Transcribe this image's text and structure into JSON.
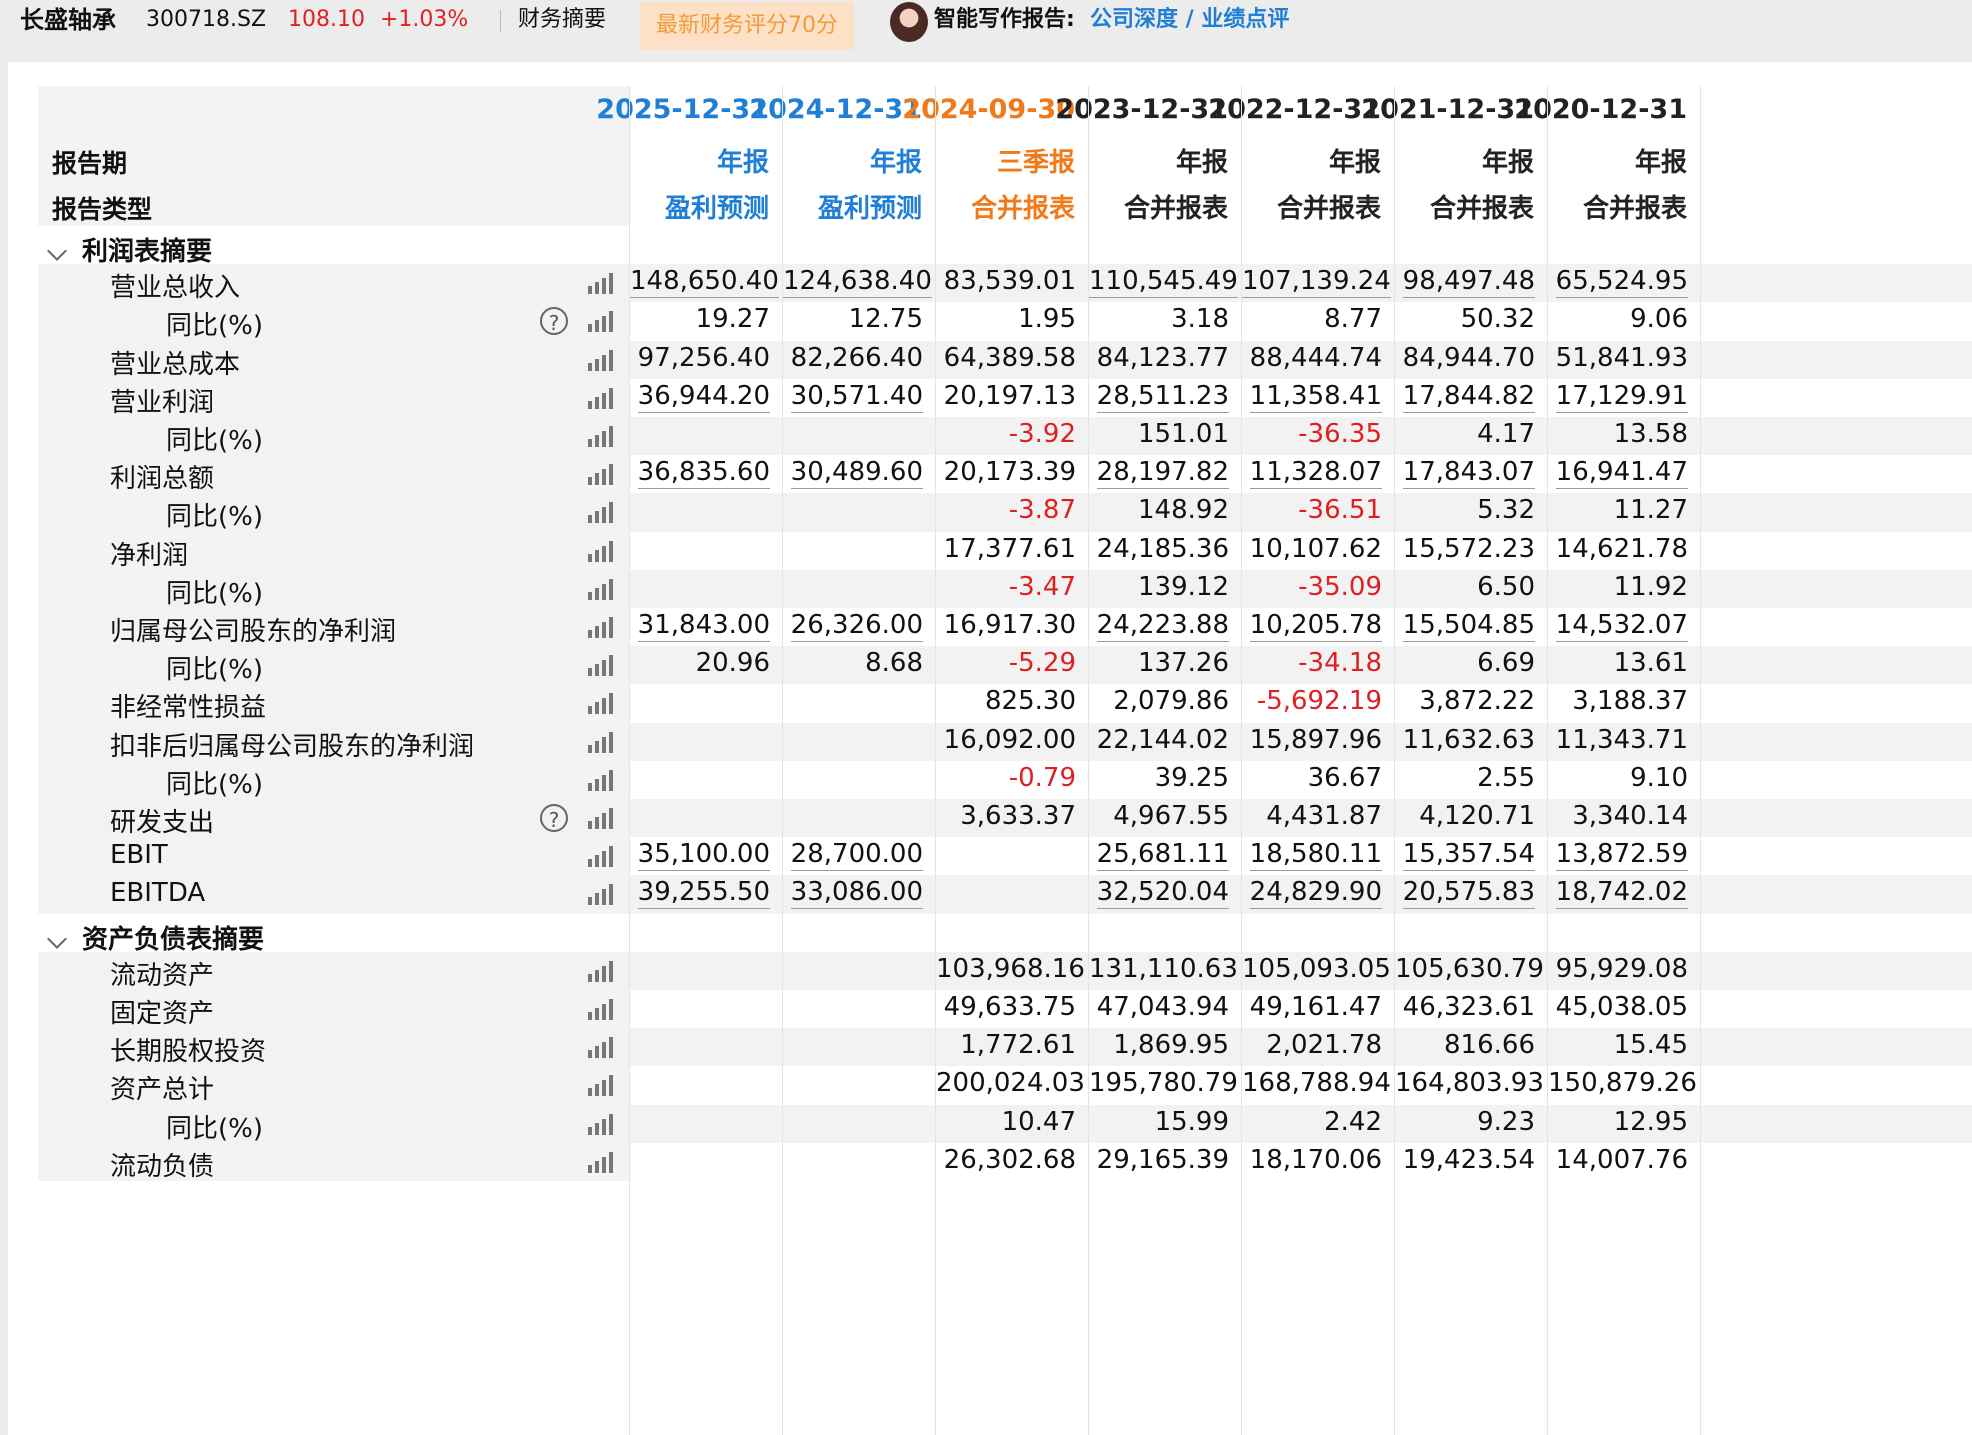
{
  "topbar": {
    "name": "长盛轴承",
    "code": "300718.SZ",
    "price": "108.10",
    "change": "+1.03%",
    "summary_label": "财务摘要",
    "score_label": "最新财务评分70分",
    "ai_label": "智能写作报告:",
    "ai_links": "公司深度 / 业绩点评",
    "avatar_icon": "avatar-icon"
  },
  "header": {
    "label_period": "报告期",
    "label_type": "报告类型",
    "columns": [
      {
        "date": "2025-12-31",
        "period": "年报",
        "kind": "盈利预测",
        "color": "#1f7fd6"
      },
      {
        "date": "2024-12-31",
        "period": "年报",
        "kind": "盈利预测",
        "color": "#1f7fd6"
      },
      {
        "date": "2024-09-30",
        "period": "三季报",
        "kind": "合并报表",
        "color": "#f07a1a"
      },
      {
        "date": "2023-12-31",
        "period": "年报",
        "kind": "合并报表",
        "color": "#222222"
      },
      {
        "date": "2022-12-31",
        "period": "年报",
        "kind": "合并报表",
        "color": "#222222"
      },
      {
        "date": "2021-12-31",
        "period": "年报",
        "kind": "合并报表",
        "color": "#222222"
      },
      {
        "date": "2020-12-31",
        "period": "年报",
        "kind": "合并报表",
        "color": "#222222"
      }
    ]
  },
  "rows": [
    {
      "type": "section",
      "name": "利润表摘要"
    },
    {
      "type": "item",
      "level": 1,
      "name": "营业总收入",
      "values": [
        "148,650.40",
        "124,638.40",
        "83,539.01",
        "110,545.49",
        "107,139.24",
        "98,497.48",
        "65,524.95"
      ]
    },
    {
      "type": "item",
      "level": 2,
      "name": "同比(%)",
      "help": true,
      "values": [
        "19.27",
        "12.75",
        "1.95",
        "3.18",
        "8.77",
        "50.32",
        "9.06"
      ]
    },
    {
      "type": "item",
      "level": 1,
      "name": "营业总成本",
      "values": [
        "97,256.40",
        "82,266.40",
        "64,389.58",
        "84,123.77",
        "88,444.74",
        "84,944.70",
        "51,841.93"
      ]
    },
    {
      "type": "item",
      "level": 1,
      "name": "营业利润",
      "values": [
        "36,944.20",
        "30,571.40",
        "20,197.13",
        "28,511.23",
        "11,358.41",
        "17,844.82",
        "17,129.91"
      ]
    },
    {
      "type": "item",
      "level": 2,
      "name": "同比(%)",
      "values": [
        "",
        "",
        "-3.92",
        "151.01",
        "-36.35",
        "4.17",
        "13.58"
      ]
    },
    {
      "type": "item",
      "level": 1,
      "name": "利润总额",
      "values": [
        "36,835.60",
        "30,489.60",
        "20,173.39",
        "28,197.82",
        "11,328.07",
        "17,843.07",
        "16,941.47"
      ]
    },
    {
      "type": "item",
      "level": 2,
      "name": "同比(%)",
      "values": [
        "",
        "",
        "-3.87",
        "148.92",
        "-36.51",
        "5.32",
        "11.27"
      ]
    },
    {
      "type": "item",
      "level": 1,
      "name": "净利润",
      "values": [
        "",
        "",
        "17,377.61",
        "24,185.36",
        "10,107.62",
        "15,572.23",
        "14,621.78"
      ]
    },
    {
      "type": "item",
      "level": 2,
      "name": "同比(%)",
      "values": [
        "",
        "",
        "-3.47",
        "139.12",
        "-35.09",
        "6.50",
        "11.92"
      ]
    },
    {
      "type": "item",
      "level": 1,
      "name": "归属母公司股东的净利润",
      "values": [
        "31,843.00",
        "26,326.00",
        "16,917.30",
        "24,223.88",
        "10,205.78",
        "15,504.85",
        "14,532.07"
      ]
    },
    {
      "type": "item",
      "level": 2,
      "name": "同比(%)",
      "values": [
        "20.96",
        "8.68",
        "-5.29",
        "137.26",
        "-34.18",
        "6.69",
        "13.61"
      ]
    },
    {
      "type": "item",
      "level": 1,
      "name": "非经常性损益",
      "values": [
        "",
        "",
        "825.30",
        "2,079.86",
        "-5,692.19",
        "3,872.22",
        "3,188.37"
      ]
    },
    {
      "type": "item",
      "level": 1,
      "name": "扣非后归属母公司股东的净利润",
      "values": [
        "",
        "",
        "16,092.00",
        "22,144.02",
        "15,897.96",
        "11,632.63",
        "11,343.71"
      ]
    },
    {
      "type": "item",
      "level": 2,
      "name": "同比(%)",
      "values": [
        "",
        "",
        "-0.79",
        "39.25",
        "36.67",
        "2.55",
        "9.10"
      ]
    },
    {
      "type": "item",
      "level": 1,
      "name": "研发支出",
      "help": true,
      "values": [
        "",
        "",
        "3,633.37",
        "4,967.55",
        "4,431.87",
        "4,120.71",
        "3,340.14"
      ]
    },
    {
      "type": "item",
      "level": 1,
      "name": "EBIT",
      "values": [
        "35,100.00",
        "28,700.00",
        "",
        "25,681.11",
        "18,580.11",
        "15,357.54",
        "13,872.59"
      ]
    },
    {
      "type": "item",
      "level": 1,
      "name": "EBITDA",
      "values": [
        "39,255.50",
        "33,086.00",
        "",
        "32,520.04",
        "24,829.90",
        "20,575.83",
        "18,742.02"
      ]
    },
    {
      "type": "section",
      "name": "资产负债表摘要"
    },
    {
      "type": "item",
      "level": 1,
      "name": "流动资产",
      "values": [
        "",
        "",
        "103,968.16",
        "131,110.63",
        "105,093.05",
        "105,630.79",
        "95,929.08"
      ]
    },
    {
      "type": "item",
      "level": 1,
      "name": "固定资产",
      "values": [
        "",
        "",
        "49,633.75",
        "47,043.94",
        "49,161.47",
        "46,323.61",
        "45,038.05"
      ]
    },
    {
      "type": "item",
      "level": 1,
      "name": "长期股权投资",
      "values": [
        "",
        "",
        "1,772.61",
        "1,869.95",
        "2,021.78",
        "816.66",
        "15.45"
      ]
    },
    {
      "type": "item",
      "level": 1,
      "name": "资产总计",
      "values": [
        "",
        "",
        "200,024.03",
        "195,780.79",
        "168,788.94",
        "164,803.93",
        "150,879.26"
      ]
    },
    {
      "type": "item",
      "level": 2,
      "name": "同比(%)",
      "values": [
        "",
        "",
        "10.47",
        "15.99",
        "2.42",
        "9.23",
        "12.95"
      ]
    },
    {
      "type": "item",
      "level": 1,
      "name": "流动负债",
      "values": [
        "",
        "",
        "26,302.68",
        "29,165.39",
        "18,170.06",
        "19,423.54",
        "14,007.76"
      ]
    }
  ],
  "underlined_rows": [
    "营业总收入",
    "营业利润",
    "利润总额",
    "归属母公司股东的净利润",
    "EBIT",
    "EBITDA"
  ]
}
